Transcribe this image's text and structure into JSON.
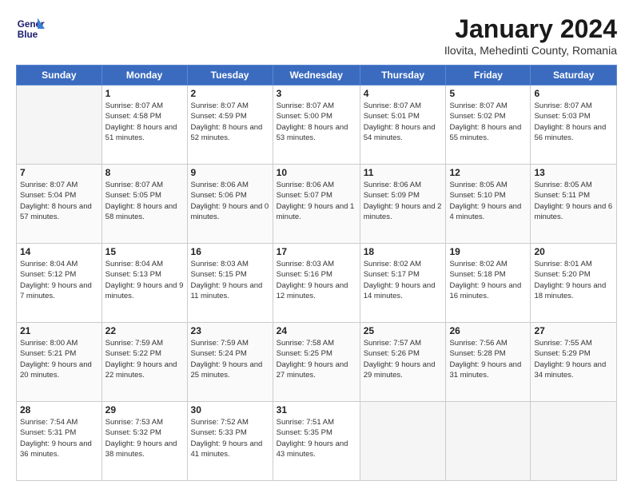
{
  "header": {
    "logo_line1": "General",
    "logo_line2": "Blue",
    "main_title": "January 2024",
    "subtitle": "Ilovita, Mehedinti County, Romania"
  },
  "weekdays": [
    "Sunday",
    "Monday",
    "Tuesday",
    "Wednesday",
    "Thursday",
    "Friday",
    "Saturday"
  ],
  "weeks": [
    [
      {
        "day": "",
        "empty": true
      },
      {
        "day": "1",
        "sunrise": "8:07 AM",
        "sunset": "4:58 PM",
        "daylight": "8 hours and 51 minutes."
      },
      {
        "day": "2",
        "sunrise": "8:07 AM",
        "sunset": "4:59 PM",
        "daylight": "8 hours and 52 minutes."
      },
      {
        "day": "3",
        "sunrise": "8:07 AM",
        "sunset": "5:00 PM",
        "daylight": "8 hours and 53 minutes."
      },
      {
        "day": "4",
        "sunrise": "8:07 AM",
        "sunset": "5:01 PM",
        "daylight": "8 hours and 54 minutes."
      },
      {
        "day": "5",
        "sunrise": "8:07 AM",
        "sunset": "5:02 PM",
        "daylight": "8 hours and 55 minutes."
      },
      {
        "day": "6",
        "sunrise": "8:07 AM",
        "sunset": "5:03 PM",
        "daylight": "8 hours and 56 minutes."
      }
    ],
    [
      {
        "day": "7",
        "sunrise": "8:07 AM",
        "sunset": "5:04 PM",
        "daylight": "8 hours and 57 minutes."
      },
      {
        "day": "8",
        "sunrise": "8:07 AM",
        "sunset": "5:05 PM",
        "daylight": "8 hours and 58 minutes."
      },
      {
        "day": "9",
        "sunrise": "8:06 AM",
        "sunset": "5:06 PM",
        "daylight": "9 hours and 0 minutes."
      },
      {
        "day": "10",
        "sunrise": "8:06 AM",
        "sunset": "5:07 PM",
        "daylight": "9 hours and 1 minute."
      },
      {
        "day": "11",
        "sunrise": "8:06 AM",
        "sunset": "5:09 PM",
        "daylight": "9 hours and 2 minutes."
      },
      {
        "day": "12",
        "sunrise": "8:05 AM",
        "sunset": "5:10 PM",
        "daylight": "9 hours and 4 minutes."
      },
      {
        "day": "13",
        "sunrise": "8:05 AM",
        "sunset": "5:11 PM",
        "daylight": "9 hours and 6 minutes."
      }
    ],
    [
      {
        "day": "14",
        "sunrise": "8:04 AM",
        "sunset": "5:12 PM",
        "daylight": "9 hours and 7 minutes."
      },
      {
        "day": "15",
        "sunrise": "8:04 AM",
        "sunset": "5:13 PM",
        "daylight": "9 hours and 9 minutes."
      },
      {
        "day": "16",
        "sunrise": "8:03 AM",
        "sunset": "5:15 PM",
        "daylight": "9 hours and 11 minutes."
      },
      {
        "day": "17",
        "sunrise": "8:03 AM",
        "sunset": "5:16 PM",
        "daylight": "9 hours and 12 minutes."
      },
      {
        "day": "18",
        "sunrise": "8:02 AM",
        "sunset": "5:17 PM",
        "daylight": "9 hours and 14 minutes."
      },
      {
        "day": "19",
        "sunrise": "8:02 AM",
        "sunset": "5:18 PM",
        "daylight": "9 hours and 16 minutes."
      },
      {
        "day": "20",
        "sunrise": "8:01 AM",
        "sunset": "5:20 PM",
        "daylight": "9 hours and 18 minutes."
      }
    ],
    [
      {
        "day": "21",
        "sunrise": "8:00 AM",
        "sunset": "5:21 PM",
        "daylight": "9 hours and 20 minutes."
      },
      {
        "day": "22",
        "sunrise": "7:59 AM",
        "sunset": "5:22 PM",
        "daylight": "9 hours and 22 minutes."
      },
      {
        "day": "23",
        "sunrise": "7:59 AM",
        "sunset": "5:24 PM",
        "daylight": "9 hours and 25 minutes."
      },
      {
        "day": "24",
        "sunrise": "7:58 AM",
        "sunset": "5:25 PM",
        "daylight": "9 hours and 27 minutes."
      },
      {
        "day": "25",
        "sunrise": "7:57 AM",
        "sunset": "5:26 PM",
        "daylight": "9 hours and 29 minutes."
      },
      {
        "day": "26",
        "sunrise": "7:56 AM",
        "sunset": "5:28 PM",
        "daylight": "9 hours and 31 minutes."
      },
      {
        "day": "27",
        "sunrise": "7:55 AM",
        "sunset": "5:29 PM",
        "daylight": "9 hours and 34 minutes."
      }
    ],
    [
      {
        "day": "28",
        "sunrise": "7:54 AM",
        "sunset": "5:31 PM",
        "daylight": "9 hours and 36 minutes."
      },
      {
        "day": "29",
        "sunrise": "7:53 AM",
        "sunset": "5:32 PM",
        "daylight": "9 hours and 38 minutes."
      },
      {
        "day": "30",
        "sunrise": "7:52 AM",
        "sunset": "5:33 PM",
        "daylight": "9 hours and 41 minutes."
      },
      {
        "day": "31",
        "sunrise": "7:51 AM",
        "sunset": "5:35 PM",
        "daylight": "9 hours and 43 minutes."
      },
      {
        "day": "",
        "empty": true
      },
      {
        "day": "",
        "empty": true
      },
      {
        "day": "",
        "empty": true
      }
    ]
  ]
}
